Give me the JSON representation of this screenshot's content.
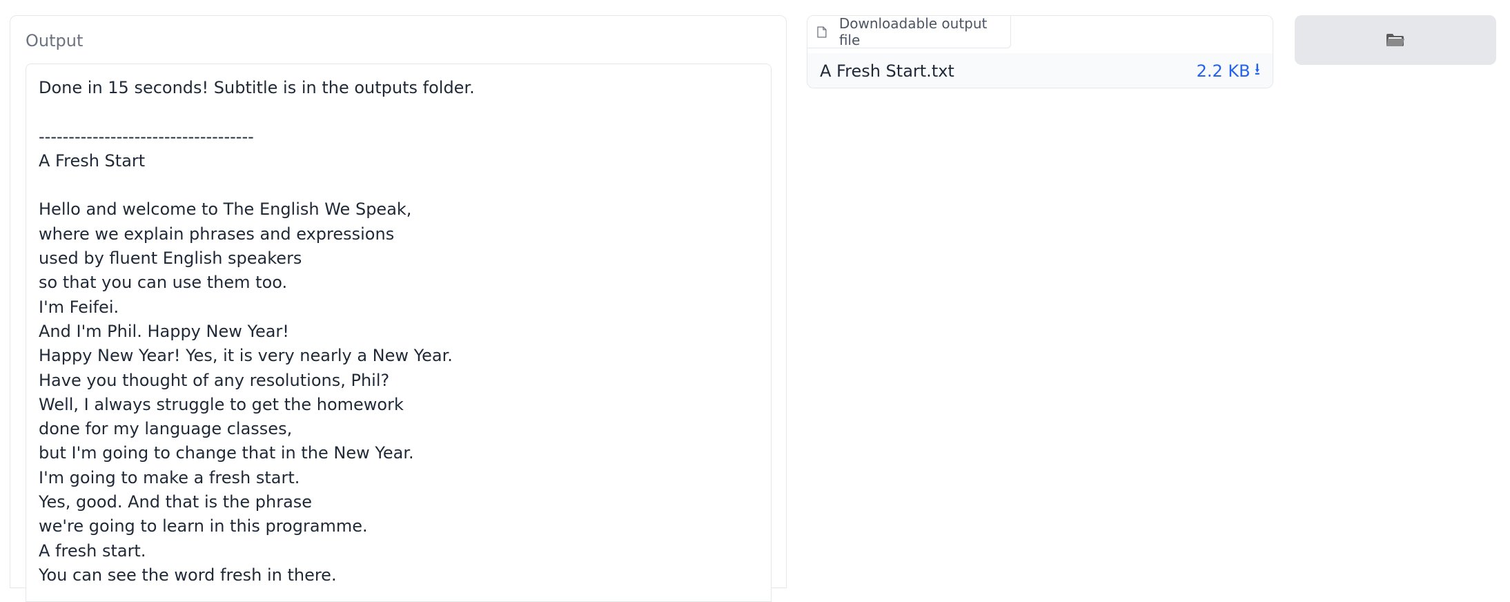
{
  "output": {
    "label": "Output",
    "text": "Done in 15 seconds! Subtitle is in the outputs folder.\n\n------------------------------------\nA Fresh Start\n\nHello and welcome to The English We Speak,\nwhere we explain phrases and expressions\nused by fluent English speakers\nso that you can use them too.\nI'm Feifei.\nAnd I'm Phil. Happy New Year!\nHappy New Year! Yes, it is very nearly a New Year.\nHave you thought of any resolutions, Phil?\nWell, I always struggle to get the homework\ndone for my language classes,\nbut I'm going to change that in the New Year.\nI'm going to make a fresh start.\nYes, good. And that is the phrase\nwe're going to learn in this programme.\nA fresh start.\nYou can see the word fresh in there."
  },
  "file": {
    "tab_label": "Downloadable output file",
    "name": "A Fresh Start.txt",
    "size": "2.2 KB",
    "download_glyph": "⭳"
  },
  "folder_button": {
    "icon": "folder-icon"
  },
  "colors": {
    "link": "#2563eb",
    "border": "#e5e7eb",
    "button_bg": "#e5e7eb"
  }
}
